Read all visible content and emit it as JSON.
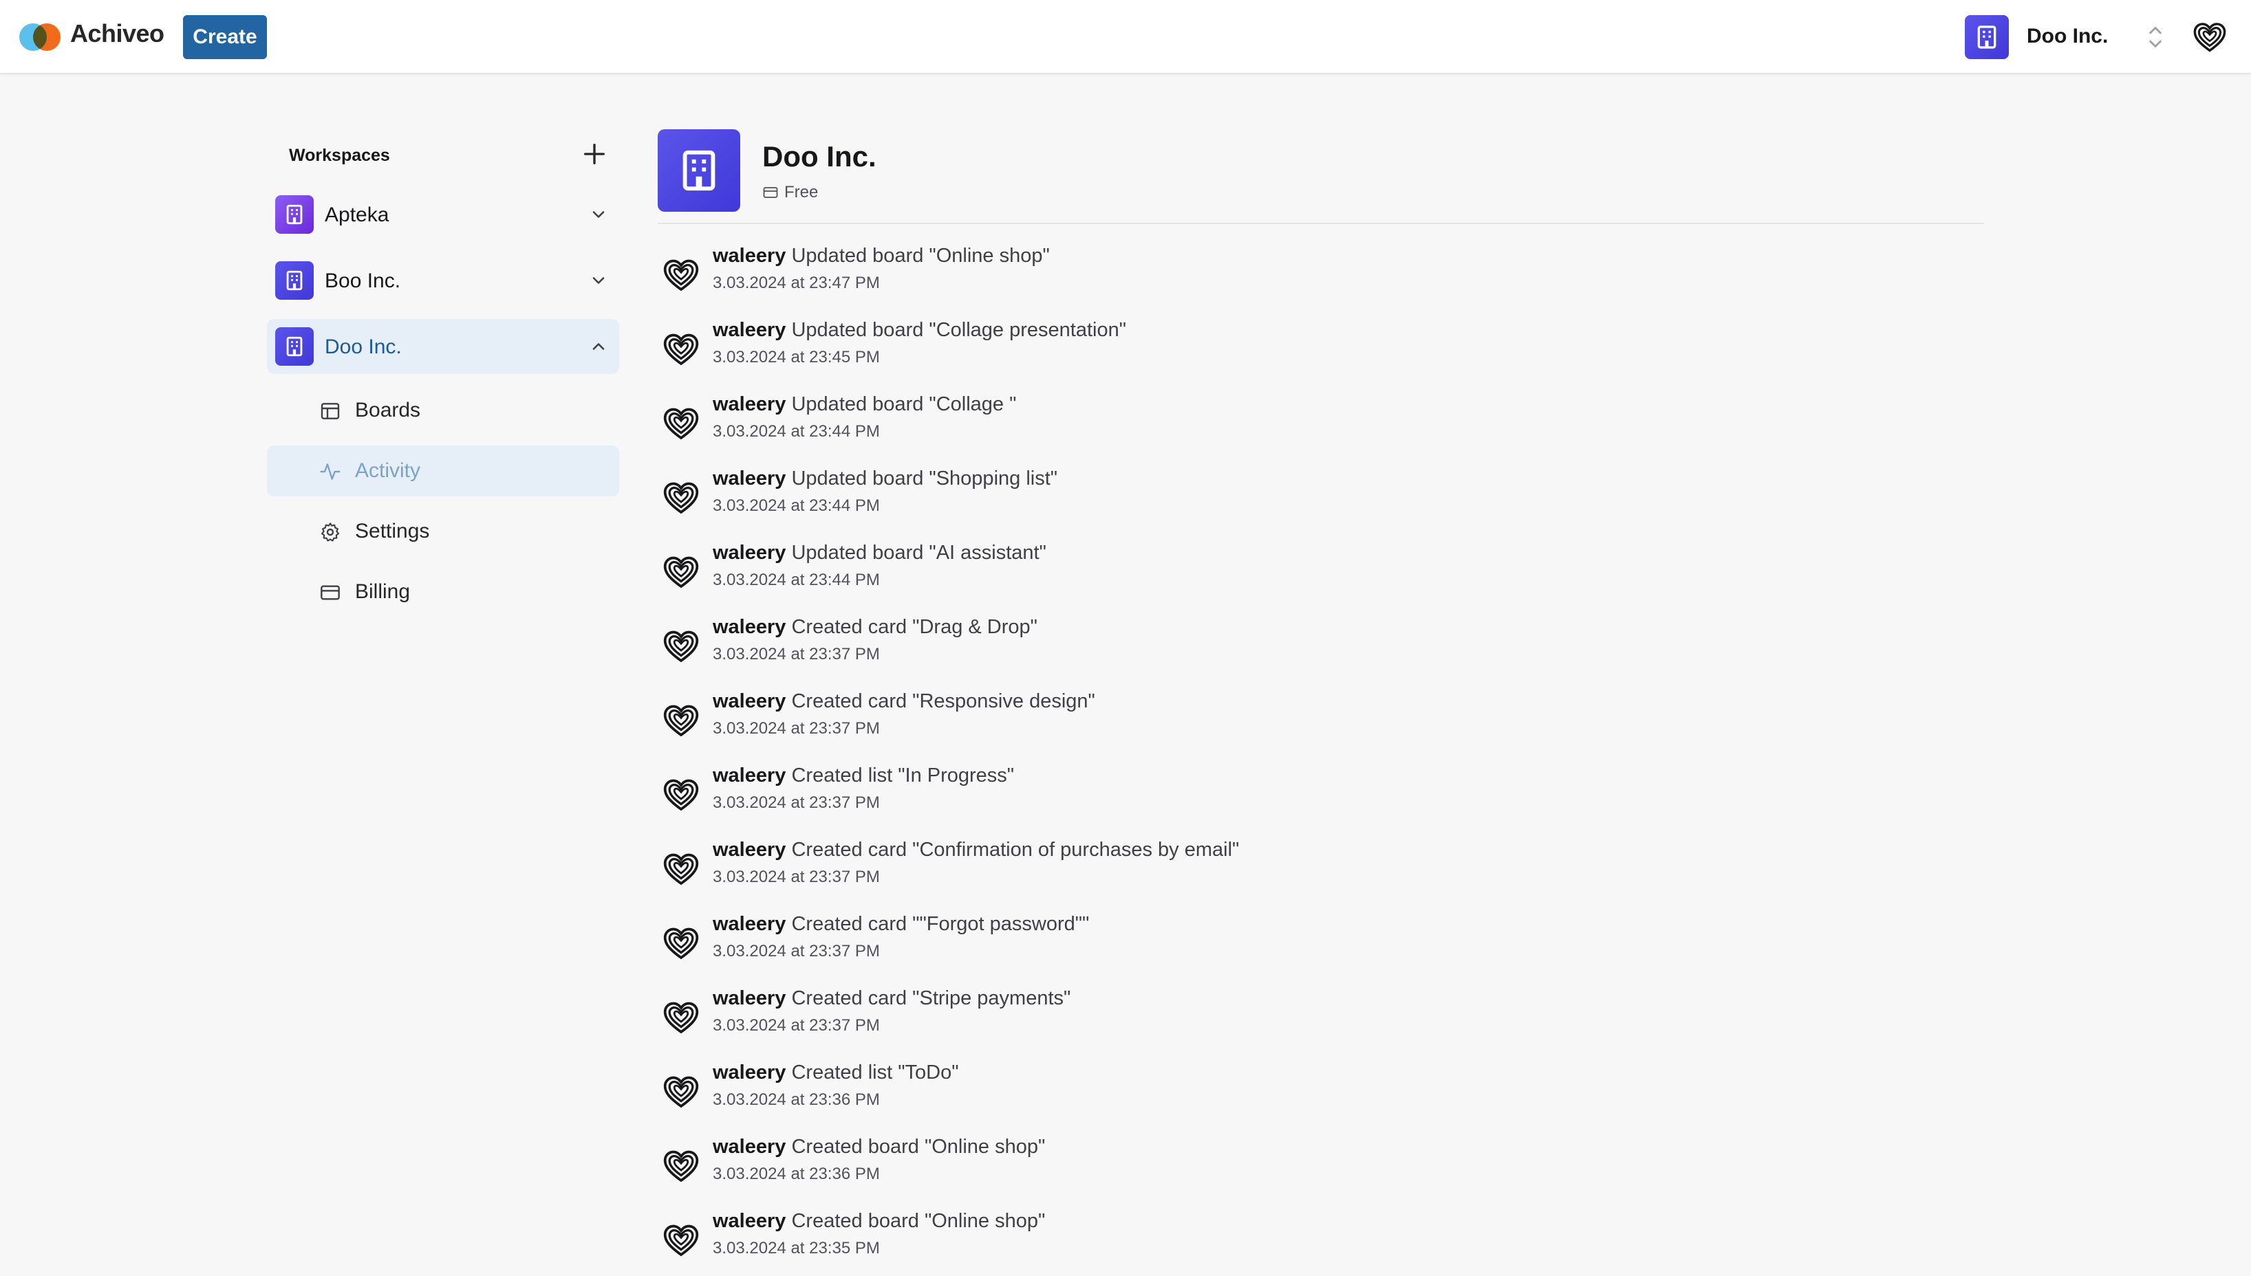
{
  "app": {
    "name": "Achiveo"
  },
  "navbar": {
    "create_label": "Create",
    "current_org": "Doo Inc."
  },
  "colors": {
    "accent": "#2364a3",
    "org_avatar": "#4f46e5",
    "apteka_avatar": "#7c3aed",
    "active_bg": "#e6eef7"
  },
  "sidebar": {
    "header": "Workspaces",
    "workspaces": [
      {
        "name": "Apteka",
        "expanded": false,
        "icon": "building-icon",
        "chevron": "chevron-down-icon"
      },
      {
        "name": "Boo Inc.",
        "expanded": false,
        "icon": "building-icon",
        "chevron": "chevron-down-icon"
      },
      {
        "name": "Doo Inc.",
        "expanded": true,
        "icon": "building-icon",
        "chevron": "chevron-up-icon"
      }
    ],
    "subitems": [
      {
        "label": "Boards",
        "icon": "layout-icon",
        "active": false
      },
      {
        "label": "Activity",
        "icon": "activity-icon",
        "active": true
      },
      {
        "label": "Settings",
        "icon": "gear-icon",
        "active": false
      },
      {
        "label": "Billing",
        "icon": "credit-card-icon",
        "active": false
      }
    ]
  },
  "main": {
    "org_name": "Doo Inc.",
    "plan": "Free",
    "activities": [
      {
        "user": "waleery",
        "action": "Updated board \"Online shop\"",
        "time": "3.03.2024 at 23:47 PM"
      },
      {
        "user": "waleery",
        "action": "Updated board \"Collage presentation\"",
        "time": "3.03.2024 at 23:45 PM"
      },
      {
        "user": "waleery",
        "action": "Updated board \"Collage \"",
        "time": "3.03.2024 at 23:44 PM"
      },
      {
        "user": "waleery",
        "action": "Updated board \"Shopping list\"",
        "time": "3.03.2024 at 23:44 PM"
      },
      {
        "user": "waleery",
        "action": "Updated board \"AI assistant\"",
        "time": "3.03.2024 at 23:44 PM"
      },
      {
        "user": "waleery",
        "action": "Created card \"Drag & Drop\"",
        "time": "3.03.2024 at 23:37 PM"
      },
      {
        "user": "waleery",
        "action": "Created card \"Responsive design\"",
        "time": "3.03.2024 at 23:37 PM"
      },
      {
        "user": "waleery",
        "action": "Created list \"In Progress\"",
        "time": "3.03.2024 at 23:37 PM"
      },
      {
        "user": "waleery",
        "action": "Created card \"Confirmation of purchases by email\"",
        "time": "3.03.2024 at 23:37 PM"
      },
      {
        "user": "waleery",
        "action": "Created card \"\"Forgot password\"\"",
        "time": "3.03.2024 at 23:37 PM"
      },
      {
        "user": "waleery",
        "action": "Created card \"Stripe payments\"",
        "time": "3.03.2024 at 23:37 PM"
      },
      {
        "user": "waleery",
        "action": "Created list \"ToDo\"",
        "time": "3.03.2024 at 23:36 PM"
      },
      {
        "user": "waleery",
        "action": "Created board \"Online shop\"",
        "time": "3.03.2024 at 23:36 PM"
      },
      {
        "user": "waleery",
        "action": "Created board \"Online shop\"",
        "time": "3.03.2024 at 23:35 PM"
      }
    ]
  }
}
